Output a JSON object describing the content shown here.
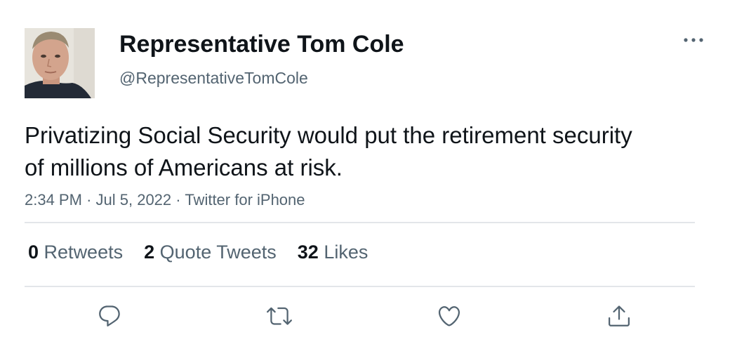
{
  "author": {
    "display_name": "Representative Tom Cole",
    "handle": "@RepresentativeTomCole",
    "avatar_icon": "user-photo-avatar"
  },
  "tweet": {
    "text": "Privatizing Social Security would put the retirement security of millions of Americans at risk.",
    "time": "2:34 PM",
    "date": "Jul 5, 2022",
    "source": "Twitter for iPhone",
    "separator": "·"
  },
  "stats": {
    "retweets": {
      "count": "0",
      "label": "Retweets"
    },
    "quote_tweets": {
      "count": "2",
      "label": "Quote Tweets"
    },
    "likes": {
      "count": "32",
      "label": "Likes"
    }
  },
  "actions": [
    {
      "icon": "reply-icon"
    },
    {
      "icon": "retweet-icon"
    },
    {
      "icon": "like-icon"
    },
    {
      "icon": "share-icon"
    }
  ],
  "colors": {
    "text_primary": "#0f1419",
    "text_secondary": "#536471",
    "divider": "#e3e6e9",
    "icon": "#536471"
  }
}
